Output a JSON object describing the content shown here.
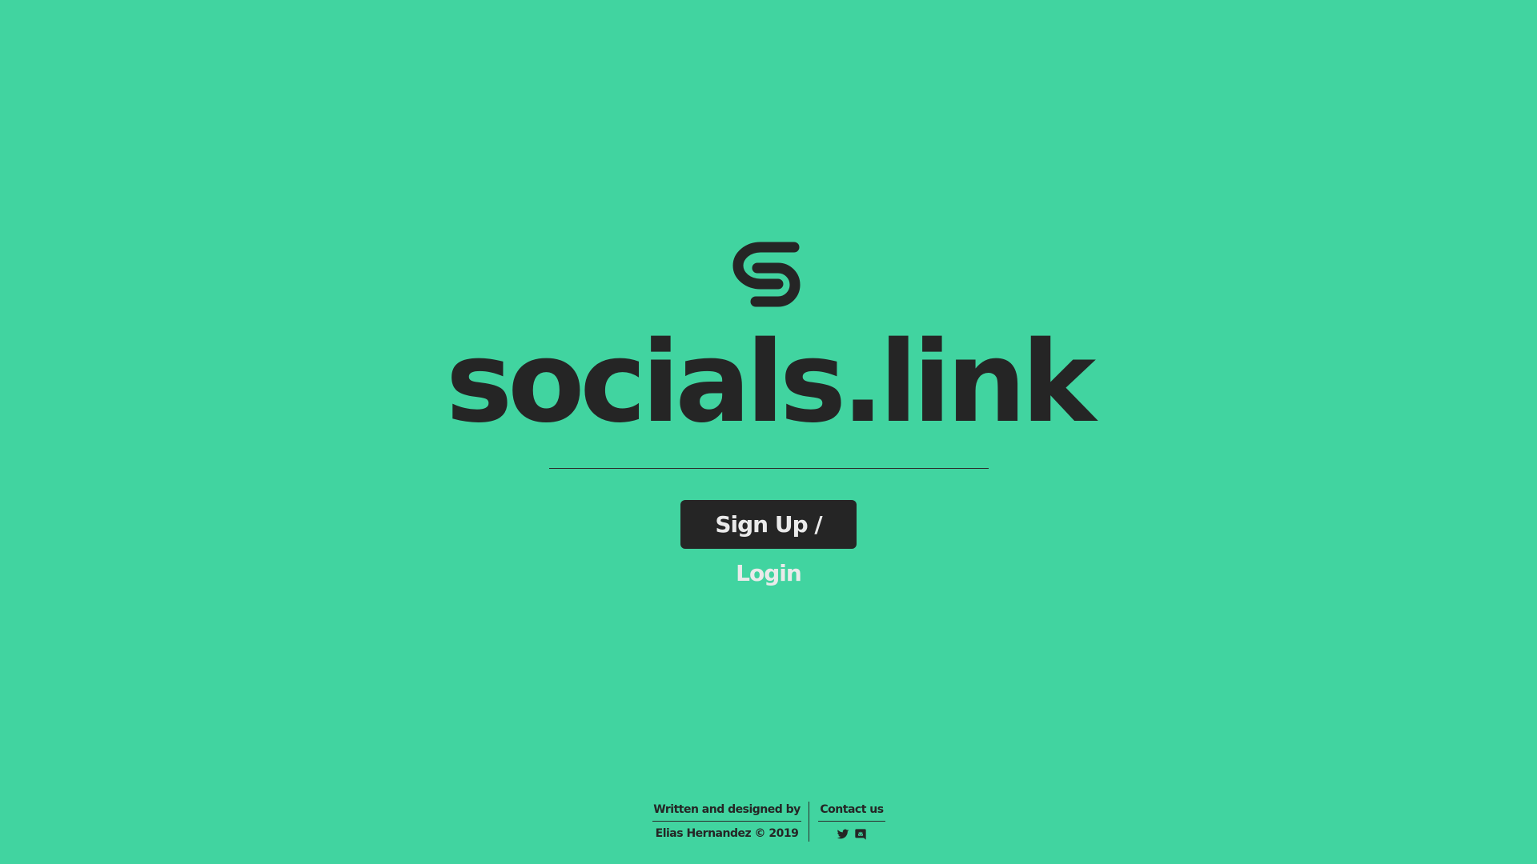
{
  "brand": {
    "logo_icon": "socials-link-s-logo-icon",
    "title": "socials.link"
  },
  "colors": {
    "background": "#41d4a0",
    "text": "#252525",
    "button_bg": "#252525",
    "button_text": "#eaeaea"
  },
  "main": {
    "cta_label": "Sign Up / Login"
  },
  "footer": {
    "credit_label": "Written and designed by",
    "credit_name": "Elias Hernandez © 2019",
    "contact_label": "Contact us",
    "contact_icons": [
      "twitter-icon",
      "discord-icon"
    ]
  }
}
